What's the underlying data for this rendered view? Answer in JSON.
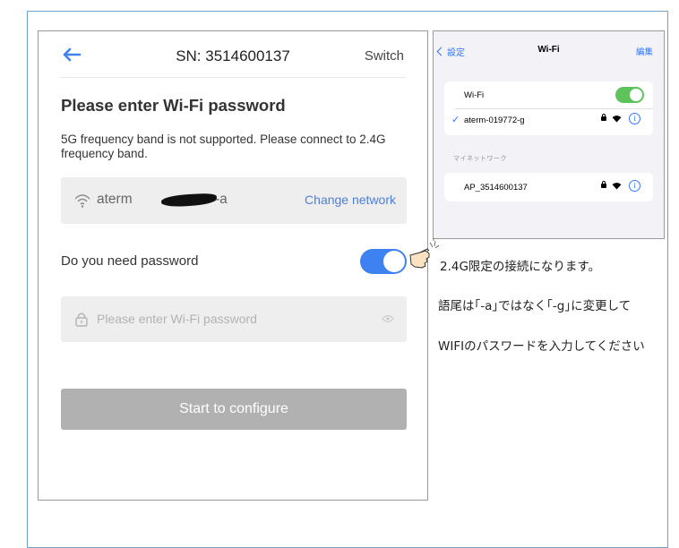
{
  "app": {
    "serial_title": "SN: 3514600137",
    "switch_label": "Switch",
    "heading": "Please enter Wi-Fi password",
    "notice": "5G frequency band is not supported. Please connect to 2.4G frequency band.",
    "network": {
      "name_prefix": "aterm",
      "name_suffix": "-a",
      "change_label": "Change network"
    },
    "password_question": "Do you need password",
    "password_toggle_on": true,
    "password_placeholder": "Please enter Wi-Fi password",
    "configure_label": "Start to configure",
    "accent_color": "#3d82f0"
  },
  "ios_settings": {
    "back_label": "設定",
    "title": "Wi-Fi",
    "edit_label": "編集",
    "wifi_label": "Wi-Fi",
    "wifi_on": true,
    "connected_network": "aterm-019772-g",
    "section_label": "マイネットワーク",
    "my_network": "AP_3514600137",
    "info_glyph": "i",
    "toggle_color": "#5fc35c"
  },
  "annotations": [
    "2.4G限定の接続になります。",
    "語尾は｢-a｣ではなく｢-g｣に変更して",
    "WIFIのパスワードを入力してください"
  ]
}
